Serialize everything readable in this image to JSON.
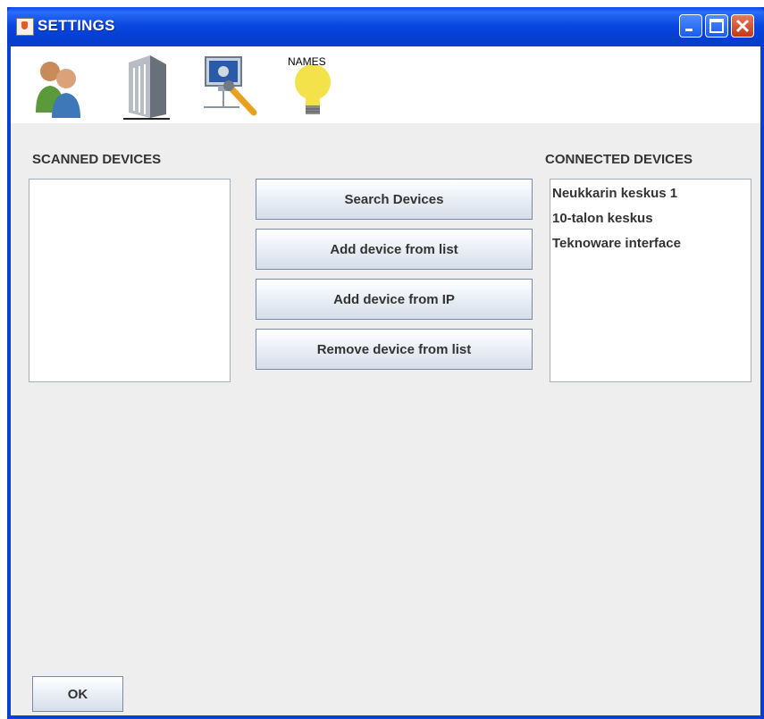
{
  "window": {
    "title": "SETTINGS",
    "icon": "java-cup-icon",
    "controls": [
      "minimize-icon",
      "maximize-icon",
      "close-icon"
    ]
  },
  "toolbar": {
    "tools": [
      {
        "icon": "users-icon"
      },
      {
        "icon": "building-icon"
      },
      {
        "icon": "network-settings-icon"
      },
      {
        "icon": "lightbulb-icon",
        "label": "NAMES"
      }
    ]
  },
  "scanned": {
    "label": "SCANNED DEVICES",
    "items": []
  },
  "connected": {
    "label": "CONNECTED DEVICES",
    "items": [
      "Neukkarin keskus 1",
      "10-talon keskus",
      "Teknoware interface"
    ]
  },
  "actions": {
    "search": "Search Devices",
    "add_from_list": "Add device from list",
    "add_from_ip": "Add device from IP",
    "remove_from_list": "Remove device from list"
  },
  "footer": {
    "ok": "OK"
  },
  "colors": {
    "titlebar": "#0a48e0",
    "client_bg": "#eeeeee",
    "text": "#333333"
  }
}
